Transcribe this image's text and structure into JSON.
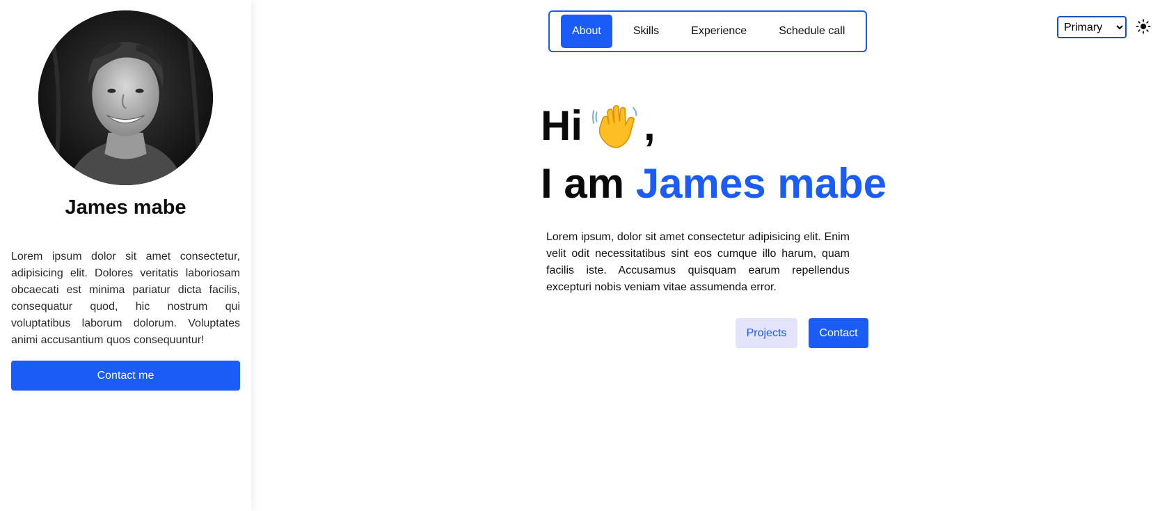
{
  "sidebar": {
    "name": "James mabe",
    "bio": "Lorem ipsum dolor sit amet consectetur, adipisicing elit. Dolores veritatis laboriosam obcaecati est minima pariatur dicta facilis, consequatur quod, hic nostrum qui voluptatibus laborum dolorum. Voluptates animi accusantium quos consequuntur!",
    "contact_button": "Contact me"
  },
  "nav": {
    "items": [
      {
        "label": "About",
        "active": true
      },
      {
        "label": "Skills",
        "active": false
      },
      {
        "label": "Experience",
        "active": false
      },
      {
        "label": "Schedule call",
        "active": false
      }
    ]
  },
  "controls": {
    "theme_select": {
      "selected": "Primary",
      "options": [
        "Primary"
      ]
    },
    "mode_icon": "sun-icon"
  },
  "hero": {
    "greeting": "Hi",
    "greeting_suffix": ",",
    "wave_icon": "waving-hand-icon",
    "intro_prefix": "I am",
    "intro_name": "James mabe",
    "description": "Lorem ipsum, dolor sit amet consectetur adipisicing elit. Enim velit odit necessitatibus sint eos cumque illo harum, quam facilis iste. Accusamus quisquam earum repellendus excepturi nobis veniam vitae assumenda error.",
    "projects_button": "Projects",
    "contact_button": "Contact"
  },
  "colors": {
    "accent": "#1a5cf5",
    "secondary_button_bg": "#e3e3fb",
    "text": "#111111",
    "background": "#ffffff"
  }
}
